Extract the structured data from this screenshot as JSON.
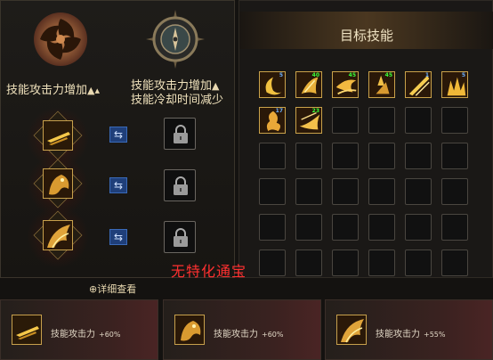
{
  "left": {
    "title_left": "技能攻击力增加",
    "title_right_line1": "技能攻击力增加",
    "title_right_line2": "技能冷却时间减少"
  },
  "right": {
    "title": "目标技能",
    "skills": [
      {
        "badge": "5",
        "badge_color": "#6ab0ff"
      },
      {
        "badge": "40",
        "badge_color": "#39ff39"
      },
      {
        "badge": "45",
        "badge_color": "#39ff39"
      },
      {
        "badge": "45",
        "badge_color": "#39ff39"
      },
      {
        "badge": "1",
        "badge_color": "#6ab0ff"
      },
      {
        "badge": "5",
        "badge_color": "#6ab0ff"
      },
      {
        "badge": "17",
        "badge_color": "#6ab0ff"
      },
      {
        "badge": "23",
        "badge_color": "#39ff39"
      }
    ]
  },
  "watermark": "无特化通宝",
  "detail_link": "详细查看",
  "bottom": [
    {
      "label": "技能攻击力",
      "value": "+60%"
    },
    {
      "label": "技能攻击力",
      "value": "+60%"
    },
    {
      "label": "技能攻击力",
      "value": "+55%"
    }
  ],
  "colors": {
    "accent_gold": "#c7a04c",
    "swap_blue": "#1f3f7a",
    "watermark_red": "#ff3030"
  }
}
